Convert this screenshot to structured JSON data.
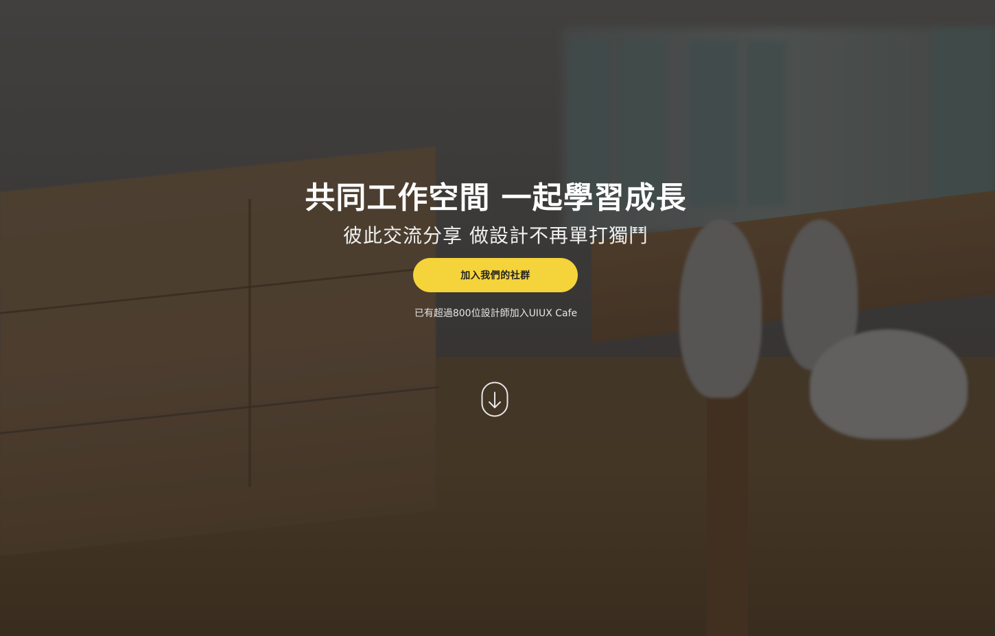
{
  "hero": {
    "title": "共同工作空間 一起學習成長",
    "subtitle": "彼此交流分享 做設計不再單打獨鬥",
    "cta_label": "加入我們的社群",
    "member_note": "已有超過800位設計師加入UIUX Cafe",
    "scroll_icon": "arrow-down-circle-icon"
  },
  "colors": {
    "accent": "#f5d33a",
    "text": "#ffffff"
  }
}
